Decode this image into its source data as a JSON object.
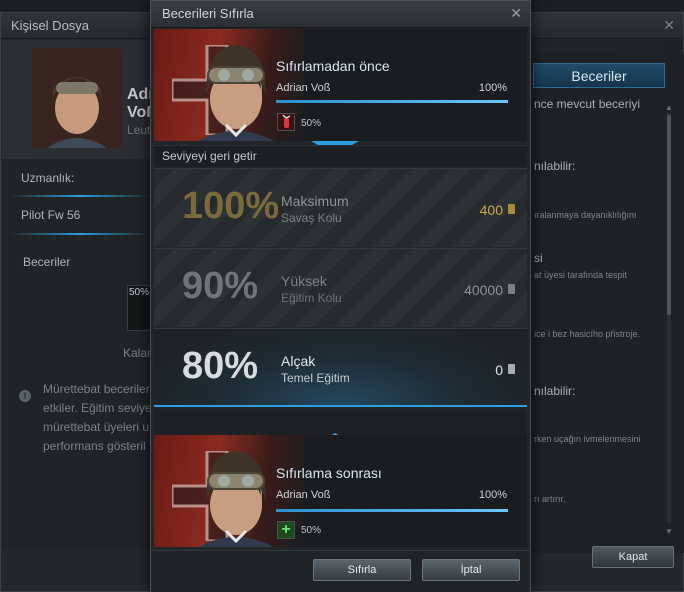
{
  "background_window": {
    "title": "Kişisel Dosya",
    "name_line1": "Adri",
    "name_line2": "Voß",
    "rank": "Leutn",
    "specialty_label": "Uzmanlık:",
    "specialty_value": "Pilot Fw 56",
    "skills_label": "Beceriler",
    "badge_pct": "50%",
    "remaining_label": "Kalan",
    "info_lines": [
      "Mürettebat becerileri",
      "etkiler. Eğitim seviye",
      "mürettebat üyeleri u",
      "performans gösteril"
    ],
    "tab_active": "Beceriler",
    "right_texts": [
      "nce mevcut beceriyi",
      "nılabilir:",
      "ıralanmaya dayanıklılığını",
      "si",
      "at üyesi tarafında tespit",
      "ice i bez hasicího přistroje.",
      "nılabilir:",
      "rken uçağın ivmelenmesini",
      "rı artırır."
    ],
    "close_button": "Kapat"
  },
  "modal": {
    "title": "Becerileri Sıfırla",
    "before": {
      "heading": "Sıfırlamadan önce",
      "crew_name": "Adrian Voß",
      "percent": "100%",
      "progress": 1.0,
      "skill_pct": "50%"
    },
    "restore_label": "Seviyeyi geri getir",
    "options": [
      {
        "pct": "100%",
        "title": "Maksimum",
        "subtitle": "Savaş Kolu",
        "cost": "400",
        "currency": "gold"
      },
      {
        "pct": "90%",
        "title": "Yüksek",
        "subtitle": "Eğitim Kolu",
        "cost": "40000",
        "currency": "silver"
      },
      {
        "pct": "80%",
        "title": "Alçak",
        "subtitle": "Temel Eğitim",
        "cost": "0",
        "currency": "silver"
      }
    ],
    "selected_option": 2,
    "after": {
      "heading": "Sıfırlama sonrası",
      "crew_name": "Adrian Voß",
      "percent": "100%",
      "progress": 1.0,
      "skill_pct": "50%"
    },
    "reset_button": "Sıfırla",
    "cancel_button": "İptal"
  },
  "colors": {
    "accent": "#2a9bdc",
    "gold": "#c9a64a",
    "panel": "#222629"
  },
  "icons": [
    "close-icon",
    "info-icon",
    "fire-extinguisher-icon",
    "plus-icon",
    "coin-icon",
    "arrow-down-icon"
  ]
}
